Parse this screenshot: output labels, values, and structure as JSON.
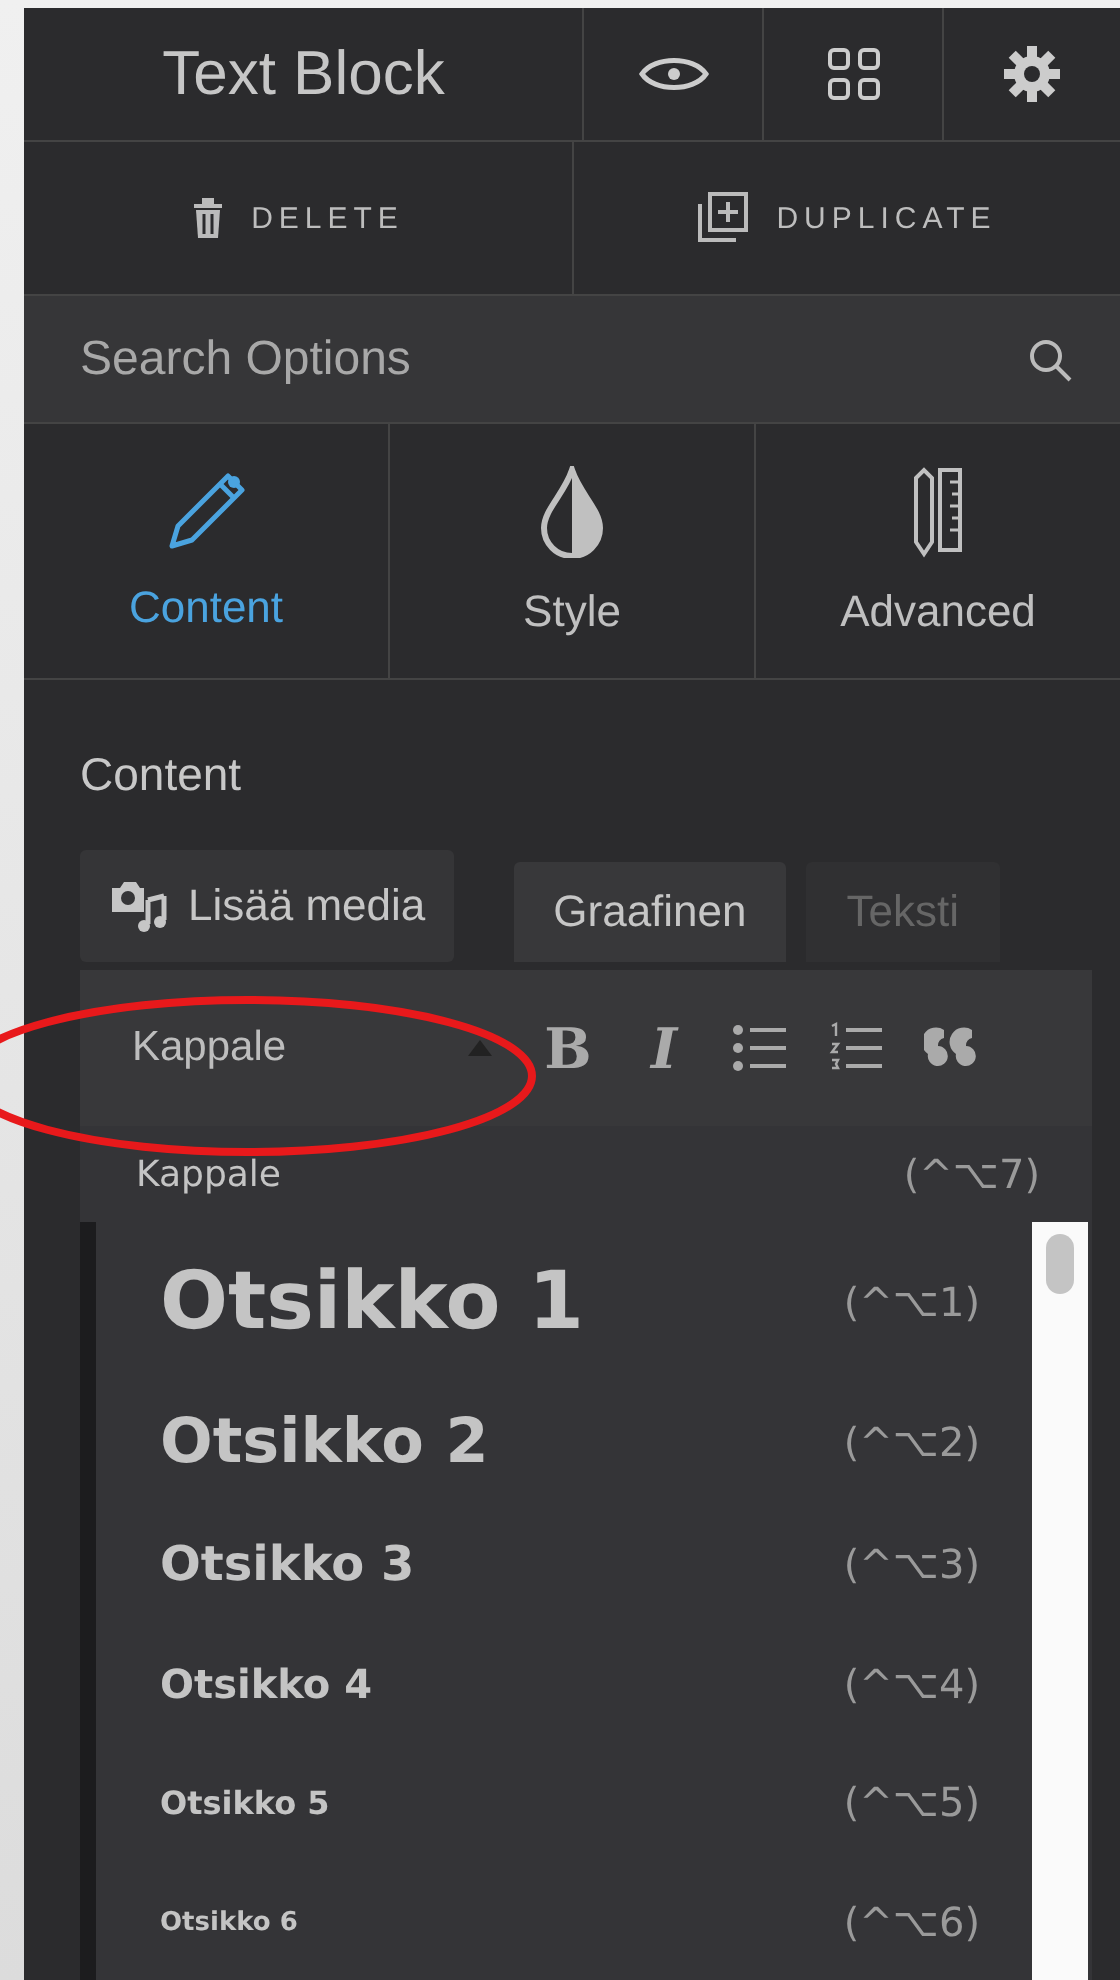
{
  "panel": {
    "title": "Text Block"
  },
  "actions": [
    {
      "label": "DELETE",
      "kind": "delete"
    },
    {
      "label": "DUPLICATE",
      "kind": "duplicate"
    }
  ],
  "search": {
    "placeholder": "Search Options"
  },
  "tabs": [
    {
      "label": "Content",
      "kind": "pencil",
      "selected": true
    },
    {
      "label": "Style",
      "kind": "drop",
      "selected": false
    },
    {
      "label": "Advanced",
      "kind": "ruler",
      "selected": false
    }
  ],
  "section": {
    "title": "Content"
  },
  "media_button": {
    "label": "Lisää media"
  },
  "editor_tabs": [
    {
      "label": "Graafinen",
      "selected": true
    },
    {
      "label": "Teksti",
      "selected": false
    }
  ],
  "format_select": {
    "value": "Kappale"
  },
  "toolbar": [
    {
      "kind": "bold",
      "label": "B"
    },
    {
      "kind": "italic",
      "label": "I"
    },
    {
      "kind": "bullets"
    },
    {
      "kind": "numbers"
    },
    {
      "kind": "quote"
    }
  ],
  "format_menu": [
    {
      "label": "Kappale",
      "kind": "p",
      "shortcut": "(^⌥7)"
    },
    {
      "label": "Otsikko 1",
      "kind": "h1",
      "shortcut": "(^⌥1)"
    },
    {
      "label": "Otsikko 2",
      "kind": "h2",
      "shortcut": "(^⌥2)"
    },
    {
      "label": "Otsikko 3",
      "kind": "h3",
      "shortcut": "(^⌥3)"
    },
    {
      "label": "Otsikko 4",
      "kind": "h4",
      "shortcut": "(^⌥4)"
    },
    {
      "label": "Otsikko 5",
      "kind": "h5",
      "shortcut": "(^⌥5)"
    },
    {
      "label": "Otsikko 6",
      "kind": "h6",
      "shortcut": "(^⌥6)"
    }
  ]
}
